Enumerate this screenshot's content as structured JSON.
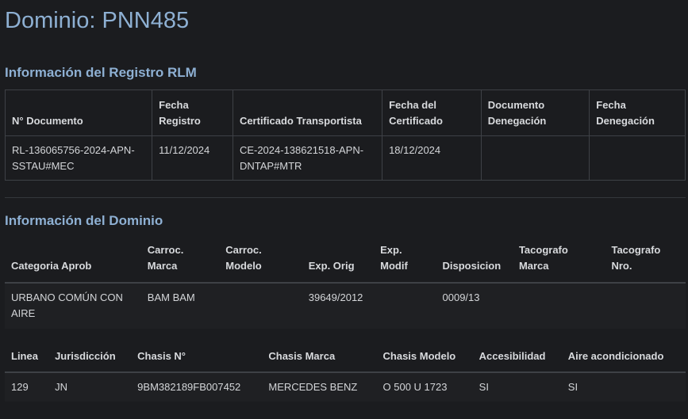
{
  "page": {
    "title": "Dominio: PNN485"
  },
  "rlm": {
    "section_title": "Información del Registro RLM",
    "headers": [
      "N° Documento",
      "Fecha Registro",
      "Certificado Transportista",
      "Fecha del Certificado",
      "Documento Denegación",
      "Fecha Denegación"
    ],
    "row": [
      "RL-136065756-2024-APN-SSTAU#MEC",
      "11/12/2024",
      "CE-2024-138621518-APN-DNTAP#MTR",
      "18/12/2024",
      "",
      ""
    ]
  },
  "dominio": {
    "section_title": "Información del Dominio",
    "headers": [
      "Categoria Aprob",
      "Carroc. Marca",
      "Carroc. Modelo",
      "Exp. Orig",
      "Exp. Modif",
      "Disposicion",
      "Tacografo Marca",
      "Tacografo Nro."
    ],
    "row": [
      "URBANO COMÚN CON AIRE",
      "BAM BAM",
      "",
      "39649/2012",
      "",
      "0009/13",
      "",
      ""
    ],
    "headers2": [
      "Linea",
      "Jurisdicción",
      "Chasis N°",
      "Chasis Marca",
      "Chasis Modelo",
      "Accesibilidad",
      "Aire acondicionado"
    ],
    "row2": [
      "129",
      "JN",
      "9BM382189FB007452",
      "MERCEDES BENZ",
      "O 500 U 1723",
      "SI",
      "SI"
    ]
  },
  "colors": {
    "background": "#1b1c1f",
    "heading": "#8eb0d3",
    "text": "#d4d6d9",
    "border": "#3e4146"
  }
}
